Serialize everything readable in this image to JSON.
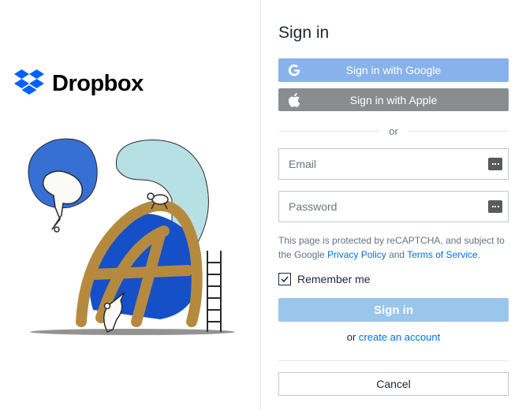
{
  "brand": {
    "name": "Dropbox"
  },
  "signin": {
    "title": "Sign in",
    "google_label": "Sign in with Google",
    "apple_label": "Sign in with Apple",
    "divider": "or",
    "email_placeholder": "Email",
    "password_placeholder": "Password",
    "recaptcha_prefix": "This page is protected by reCAPTCHA, and subject to the Google ",
    "privacy_link": "Privacy Policy",
    "recaptcha_and": " and ",
    "tos_link": "Terms of Service",
    "recaptcha_suffix": ".",
    "remember_label": "Remember me",
    "remember_checked": true,
    "signin_button": "Sign in",
    "or_text": "or ",
    "create_link": "create an account",
    "cancel_label": "Cancel"
  }
}
